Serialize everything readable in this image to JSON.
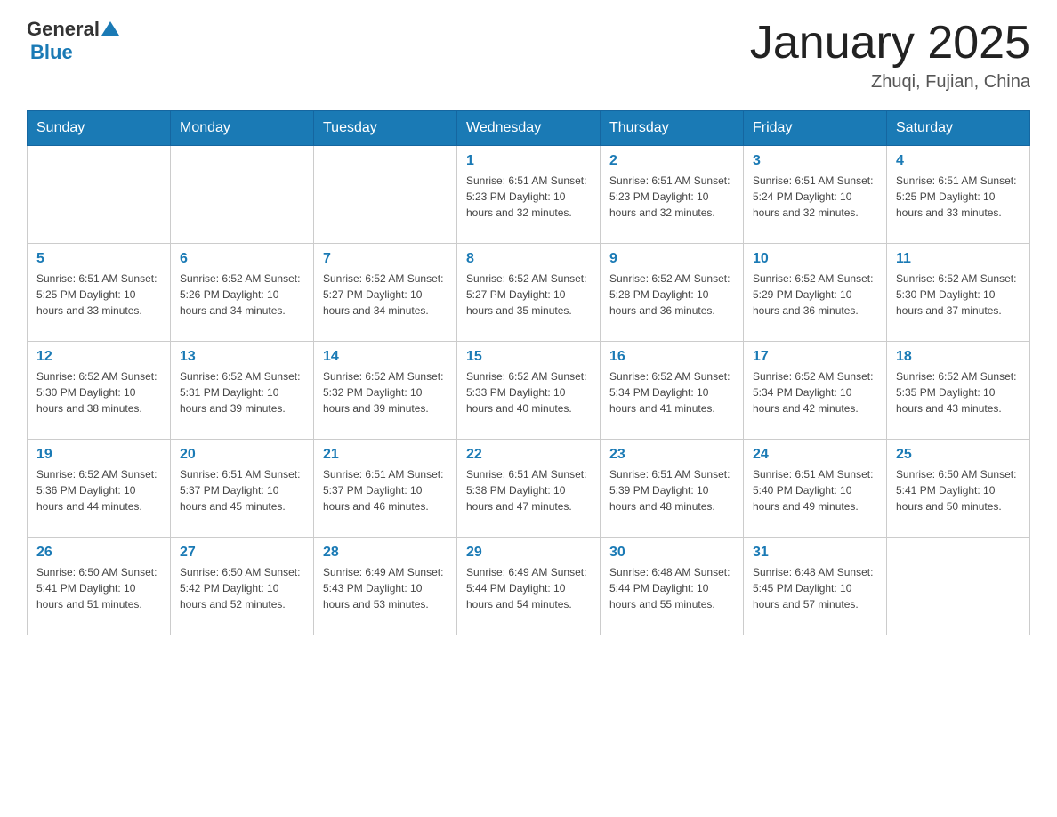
{
  "logo": {
    "general": "General",
    "triangle": "▶",
    "blue": "Blue"
  },
  "title": "January 2025",
  "location": "Zhuqi, Fujian, China",
  "headers": [
    "Sunday",
    "Monday",
    "Tuesday",
    "Wednesday",
    "Thursday",
    "Friday",
    "Saturday"
  ],
  "weeks": [
    [
      {
        "day": "",
        "info": ""
      },
      {
        "day": "",
        "info": ""
      },
      {
        "day": "",
        "info": ""
      },
      {
        "day": "1",
        "info": "Sunrise: 6:51 AM\nSunset: 5:23 PM\nDaylight: 10 hours\nand 32 minutes."
      },
      {
        "day": "2",
        "info": "Sunrise: 6:51 AM\nSunset: 5:23 PM\nDaylight: 10 hours\nand 32 minutes."
      },
      {
        "day": "3",
        "info": "Sunrise: 6:51 AM\nSunset: 5:24 PM\nDaylight: 10 hours\nand 32 minutes."
      },
      {
        "day": "4",
        "info": "Sunrise: 6:51 AM\nSunset: 5:25 PM\nDaylight: 10 hours\nand 33 minutes."
      }
    ],
    [
      {
        "day": "5",
        "info": "Sunrise: 6:51 AM\nSunset: 5:25 PM\nDaylight: 10 hours\nand 33 minutes."
      },
      {
        "day": "6",
        "info": "Sunrise: 6:52 AM\nSunset: 5:26 PM\nDaylight: 10 hours\nand 34 minutes."
      },
      {
        "day": "7",
        "info": "Sunrise: 6:52 AM\nSunset: 5:27 PM\nDaylight: 10 hours\nand 34 minutes."
      },
      {
        "day": "8",
        "info": "Sunrise: 6:52 AM\nSunset: 5:27 PM\nDaylight: 10 hours\nand 35 minutes."
      },
      {
        "day": "9",
        "info": "Sunrise: 6:52 AM\nSunset: 5:28 PM\nDaylight: 10 hours\nand 36 minutes."
      },
      {
        "day": "10",
        "info": "Sunrise: 6:52 AM\nSunset: 5:29 PM\nDaylight: 10 hours\nand 36 minutes."
      },
      {
        "day": "11",
        "info": "Sunrise: 6:52 AM\nSunset: 5:30 PM\nDaylight: 10 hours\nand 37 minutes."
      }
    ],
    [
      {
        "day": "12",
        "info": "Sunrise: 6:52 AM\nSunset: 5:30 PM\nDaylight: 10 hours\nand 38 minutes."
      },
      {
        "day": "13",
        "info": "Sunrise: 6:52 AM\nSunset: 5:31 PM\nDaylight: 10 hours\nand 39 minutes."
      },
      {
        "day": "14",
        "info": "Sunrise: 6:52 AM\nSunset: 5:32 PM\nDaylight: 10 hours\nand 39 minutes."
      },
      {
        "day": "15",
        "info": "Sunrise: 6:52 AM\nSunset: 5:33 PM\nDaylight: 10 hours\nand 40 minutes."
      },
      {
        "day": "16",
        "info": "Sunrise: 6:52 AM\nSunset: 5:34 PM\nDaylight: 10 hours\nand 41 minutes."
      },
      {
        "day": "17",
        "info": "Sunrise: 6:52 AM\nSunset: 5:34 PM\nDaylight: 10 hours\nand 42 minutes."
      },
      {
        "day": "18",
        "info": "Sunrise: 6:52 AM\nSunset: 5:35 PM\nDaylight: 10 hours\nand 43 minutes."
      }
    ],
    [
      {
        "day": "19",
        "info": "Sunrise: 6:52 AM\nSunset: 5:36 PM\nDaylight: 10 hours\nand 44 minutes."
      },
      {
        "day": "20",
        "info": "Sunrise: 6:51 AM\nSunset: 5:37 PM\nDaylight: 10 hours\nand 45 minutes."
      },
      {
        "day": "21",
        "info": "Sunrise: 6:51 AM\nSunset: 5:37 PM\nDaylight: 10 hours\nand 46 minutes."
      },
      {
        "day": "22",
        "info": "Sunrise: 6:51 AM\nSunset: 5:38 PM\nDaylight: 10 hours\nand 47 minutes."
      },
      {
        "day": "23",
        "info": "Sunrise: 6:51 AM\nSunset: 5:39 PM\nDaylight: 10 hours\nand 48 minutes."
      },
      {
        "day": "24",
        "info": "Sunrise: 6:51 AM\nSunset: 5:40 PM\nDaylight: 10 hours\nand 49 minutes."
      },
      {
        "day": "25",
        "info": "Sunrise: 6:50 AM\nSunset: 5:41 PM\nDaylight: 10 hours\nand 50 minutes."
      }
    ],
    [
      {
        "day": "26",
        "info": "Sunrise: 6:50 AM\nSunset: 5:41 PM\nDaylight: 10 hours\nand 51 minutes."
      },
      {
        "day": "27",
        "info": "Sunrise: 6:50 AM\nSunset: 5:42 PM\nDaylight: 10 hours\nand 52 minutes."
      },
      {
        "day": "28",
        "info": "Sunrise: 6:49 AM\nSunset: 5:43 PM\nDaylight: 10 hours\nand 53 minutes."
      },
      {
        "day": "29",
        "info": "Sunrise: 6:49 AM\nSunset: 5:44 PM\nDaylight: 10 hours\nand 54 minutes."
      },
      {
        "day": "30",
        "info": "Sunrise: 6:48 AM\nSunset: 5:44 PM\nDaylight: 10 hours\nand 55 minutes."
      },
      {
        "day": "31",
        "info": "Sunrise: 6:48 AM\nSunset: 5:45 PM\nDaylight: 10 hours\nand 57 minutes."
      },
      {
        "day": "",
        "info": ""
      }
    ]
  ]
}
